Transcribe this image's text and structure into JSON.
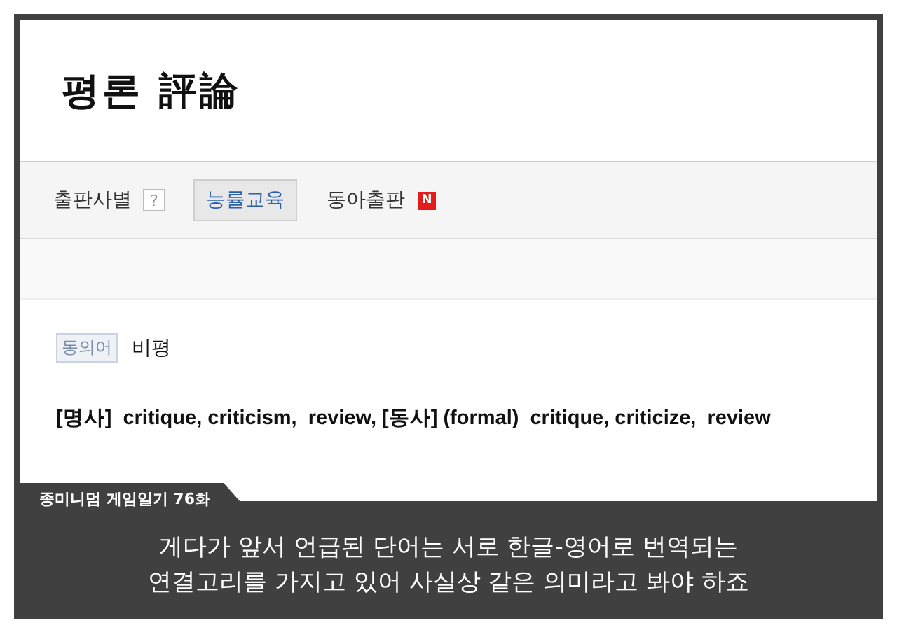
{
  "entry": {
    "title": "평론 評論"
  },
  "publishers": {
    "label": "출판사별",
    "help": "?",
    "tabs": [
      {
        "label": "능률교육",
        "selected": true
      },
      {
        "label": "동아출판",
        "selected": false,
        "badge": "N"
      }
    ]
  },
  "synonym": {
    "tag": "동의어",
    "word": "비평"
  },
  "meaning": "[명사]  critique, criticism,  review, [동사] (formal)  critique, criticize,  review",
  "caption": {
    "tag": "종미니멈 게임일기 76화",
    "lines": [
      "게다가 앞서 언급된 단어는 서로 한글-영어로 번역되는",
      "연결고리를 가지고 있어 사실상 같은 의미라고 봐야 하죠"
    ]
  }
}
